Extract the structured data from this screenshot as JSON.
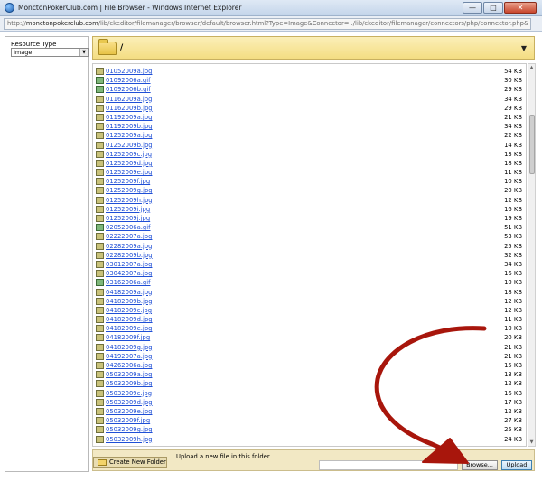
{
  "window": {
    "title": "MonctonPokerClub.com | File Browser - Windows Internet Explorer",
    "minimize": "—",
    "maximize": "□",
    "close": "✕"
  },
  "address": {
    "prefix": "http://",
    "host": "monctonpokerclub.com",
    "path": "/lib/ckeditor/filemanager/browser/default/browser.html?Type=Image&Connector=../lib/ckeditor/filemanager/connectors/php/connector.php&"
  },
  "resource_type": {
    "label": "Resource Type",
    "selected": "Image"
  },
  "folder": {
    "path": "/",
    "icon": "folder-open-icon",
    "dropdown_icon": "▼"
  },
  "files": [
    {
      "name": "01052009a.jpg",
      "size": "54 KB",
      "kind": "jpg"
    },
    {
      "name": "01092006a.gif",
      "size": "30 KB",
      "kind": "gif"
    },
    {
      "name": "01092006b.gif",
      "size": "29 KB",
      "kind": "gif"
    },
    {
      "name": "01162009a.jpg",
      "size": "34 KB",
      "kind": "jpg"
    },
    {
      "name": "01162009b.jpg",
      "size": "29 KB",
      "kind": "jpg"
    },
    {
      "name": "01192009a.jpg",
      "size": "21 KB",
      "kind": "jpg"
    },
    {
      "name": "01192009b.jpg",
      "size": "34 KB",
      "kind": "jpg"
    },
    {
      "name": "01252009a.jpg",
      "size": "22 KB",
      "kind": "jpg"
    },
    {
      "name": "01252009b.jpg",
      "size": "14 KB",
      "kind": "jpg"
    },
    {
      "name": "01252009c.jpg",
      "size": "13 KB",
      "kind": "jpg"
    },
    {
      "name": "01252009d.jpg",
      "size": "18 KB",
      "kind": "jpg"
    },
    {
      "name": "01252009e.jpg",
      "size": "11 KB",
      "kind": "jpg"
    },
    {
      "name": "01252009f.jpg",
      "size": "10 KB",
      "kind": "jpg"
    },
    {
      "name": "01252009g.jpg",
      "size": "20 KB",
      "kind": "jpg"
    },
    {
      "name": "01252009h.jpg",
      "size": "12 KB",
      "kind": "jpg"
    },
    {
      "name": "01252009i.jpg",
      "size": "16 KB",
      "kind": "jpg"
    },
    {
      "name": "01252009j.jpg",
      "size": "19 KB",
      "kind": "jpg"
    },
    {
      "name": "02052006a.gif",
      "size": "51 KB",
      "kind": "gif"
    },
    {
      "name": "02222007a.jpg",
      "size": "53 KB",
      "kind": "jpg"
    },
    {
      "name": "02282009a.jpg",
      "size": "25 KB",
      "kind": "jpg"
    },
    {
      "name": "02282009b.jpg",
      "size": "32 KB",
      "kind": "jpg"
    },
    {
      "name": "03012007a.jpg",
      "size": "34 KB",
      "kind": "jpg"
    },
    {
      "name": "03042007a.jpg",
      "size": "16 KB",
      "kind": "jpg"
    },
    {
      "name": "03162006a.gif",
      "size": "10 KB",
      "kind": "gif"
    },
    {
      "name": "04182009a.jpg",
      "size": "18 KB",
      "kind": "jpg"
    },
    {
      "name": "04182009b.jpg",
      "size": "12 KB",
      "kind": "jpg"
    },
    {
      "name": "04182009c.jpg",
      "size": "12 KB",
      "kind": "jpg"
    },
    {
      "name": "04182009d.jpg",
      "size": "11 KB",
      "kind": "jpg"
    },
    {
      "name": "04182009e.jpg",
      "size": "10 KB",
      "kind": "jpg"
    },
    {
      "name": "04182009f.jpg",
      "size": "20 KB",
      "kind": "jpg"
    },
    {
      "name": "04182009g.jpg",
      "size": "21 KB",
      "kind": "jpg"
    },
    {
      "name": "04192007a.jpg",
      "size": "21 KB",
      "kind": "jpg"
    },
    {
      "name": "04262006a.jpg",
      "size": "15 KB",
      "kind": "jpg"
    },
    {
      "name": "05032009a.jpg",
      "size": "13 KB",
      "kind": "jpg"
    },
    {
      "name": "05032009b.jpg",
      "size": "12 KB",
      "kind": "jpg"
    },
    {
      "name": "05032009c.jpg",
      "size": "16 KB",
      "kind": "jpg"
    },
    {
      "name": "05032009d.jpg",
      "size": "17 KB",
      "kind": "jpg"
    },
    {
      "name": "05032009e.jpg",
      "size": "12 KB",
      "kind": "jpg"
    },
    {
      "name": "05032009f.jpg",
      "size": "27 KB",
      "kind": "jpg"
    },
    {
      "name": "05032009g.jpg",
      "size": "25 KB",
      "kind": "jpg"
    },
    {
      "name": "05032009h.jpg",
      "size": "24 KB",
      "kind": "jpg"
    }
  ],
  "bottom": {
    "create_folder": "Create New Folder",
    "upload_label": "Upload a new file in this folder",
    "browse": "Browse...",
    "upload": "Upload"
  },
  "colors": {
    "link": "#1f4fd6",
    "folder_bar": "#f4dd82",
    "annotation_arrow": "#a8160c"
  }
}
